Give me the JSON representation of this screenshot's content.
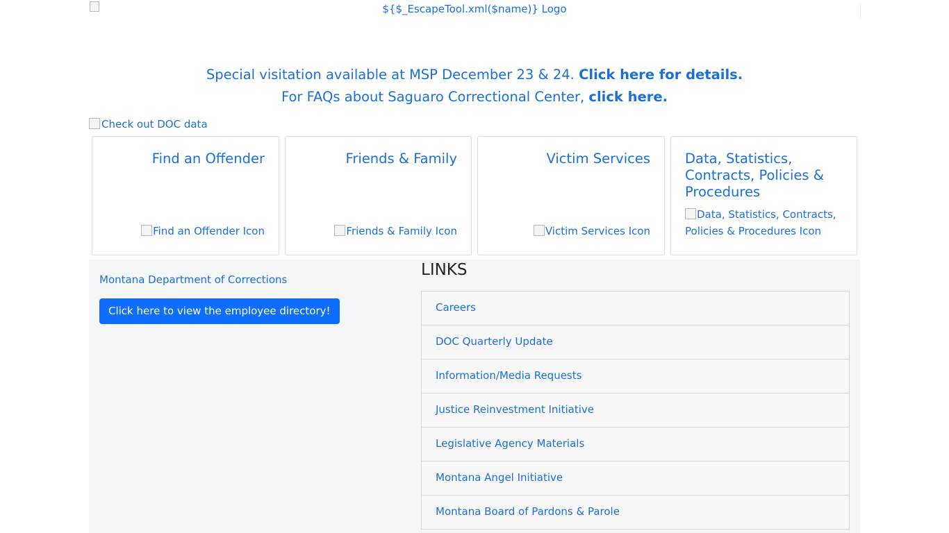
{
  "header": {
    "logo_alt": "${$_EscapeTool.xml($name)} Logo"
  },
  "alerts": [
    {
      "text": "Special visitation available at MSP December 23 & 24. ",
      "link": "Click here for details."
    },
    {
      "text": "For FAQs about Saguaro Correctional Center, ",
      "link": "click here."
    }
  ],
  "data_banner_alt": "Check out DOC data",
  "cards": [
    {
      "title": "Find an Offender",
      "icon_alt": "Find an Offender Icon"
    },
    {
      "title": "Friends & Family",
      "icon_alt": "Friends & Family Icon"
    },
    {
      "title": "Victim Services",
      "icon_alt": "Victim Services Icon"
    },
    {
      "title": "Data, Statistics, Contracts, Policies & Procedures",
      "icon_alt": "Data, Statistics, Contracts, Policies & Procedures Icon"
    }
  ],
  "sidebar": {
    "agency_link": "Montana Department of Corrections",
    "directory_button": "Click here to view the employee directory!"
  },
  "links_section": {
    "title": "LINKS",
    "items": [
      "Careers",
      "DOC Quarterly Update",
      "Information/Media Requests",
      "Justice Reinvestment Initiative",
      "Legislative Agency Materials",
      "Montana Angel Initiative",
      "Montana Board of Pardons & Parole"
    ]
  },
  "colors": {
    "link": "#1a6fd8",
    "button": "#0d6efd",
    "panel_bg": "#f5f6f7"
  }
}
